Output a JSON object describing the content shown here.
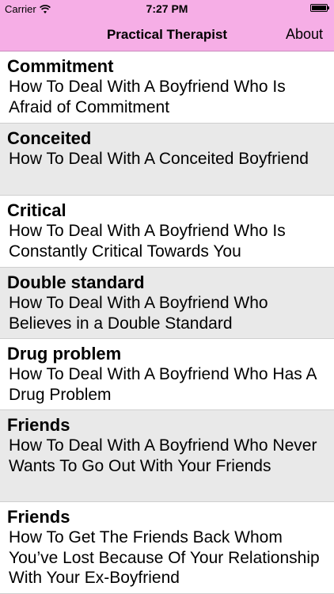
{
  "status": {
    "carrier": "Carrier",
    "time": "7:27 PM"
  },
  "nav": {
    "title": "Practical Therapist",
    "about": "About"
  },
  "items": [
    {
      "title": "Commitment",
      "subtitle": "How To Deal With A Boyfriend Who Is Afraid of Commitment"
    },
    {
      "title": "Conceited",
      "subtitle": "How To Deal With A Conceited Boyfriend"
    },
    {
      "title": "Critical",
      "subtitle": "How To Deal With A Boyfriend Who Is Constantly Critical Towards You"
    },
    {
      "title": "Double standard",
      "subtitle": "How To Deal With A Boyfriend Who Believes in a Double Standard"
    },
    {
      "title": "Drug problem",
      "subtitle": "How To Deal With A Boyfriend Who Has A Drug Problem"
    },
    {
      "title": "Friends",
      "subtitle": "How To Deal With A Boyfriend Who Never Wants To Go Out With Your Friends"
    },
    {
      "title": "Friends",
      "subtitle": "How To Get The Friends Back Whom You’ve Lost Because Of Your Relationship With Your Ex-Boyfriend"
    }
  ],
  "colors": {
    "nav_background": "#f6aee6",
    "row_alt": "#e9e9e9"
  }
}
